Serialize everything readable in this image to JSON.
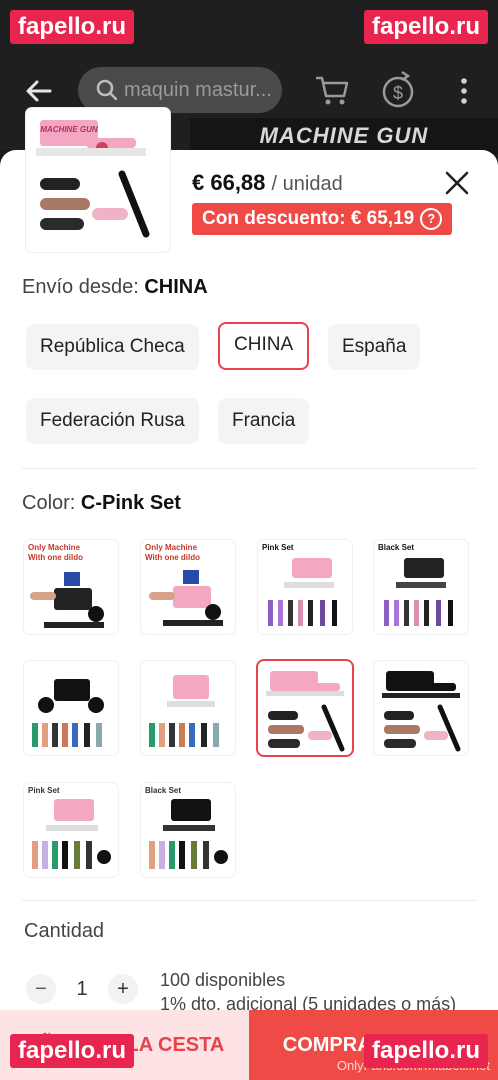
{
  "watermark": "fapello.ru",
  "topbar": {
    "search_placeholder": "maquin mastur..."
  },
  "banner_text": "MACHINE GUN",
  "product": {
    "price": "€ 66,88",
    "unit": "/ unidad",
    "discount_label": "Con descuento: € 65,19",
    "discount_help": "?"
  },
  "shipping": {
    "label": "Envío desde:",
    "selected": "CHINA",
    "options": [
      "República Checa",
      "CHINA",
      "España",
      "Federación Rusa",
      "Francia"
    ]
  },
  "color": {
    "label": "Color:",
    "selected": "C-Pink Set",
    "swatch_tags": [
      "Only Machine\nWith one dildo",
      "Only Machine\nWith one dildo",
      "Pink Set",
      "Black Set",
      "",
      "",
      "",
      "",
      "Pink Set",
      "Black Set"
    ]
  },
  "quantity": {
    "label": "Cantidad",
    "minus": "−",
    "value": "1",
    "plus": "+",
    "available": "100 disponibles",
    "extra": "1% dto. adicional (5 unidades o más)"
  },
  "actions": {
    "add_to_cart": "AÑADIR A LA CESTA",
    "buy": "COMPRAR AHORA"
  },
  "credit": "OnlyFans.com/mlabelli.net",
  "colors": {
    "accent": "#ef4a45",
    "selected_border": "#e8434d",
    "watermark_bg": "#e8254e"
  }
}
